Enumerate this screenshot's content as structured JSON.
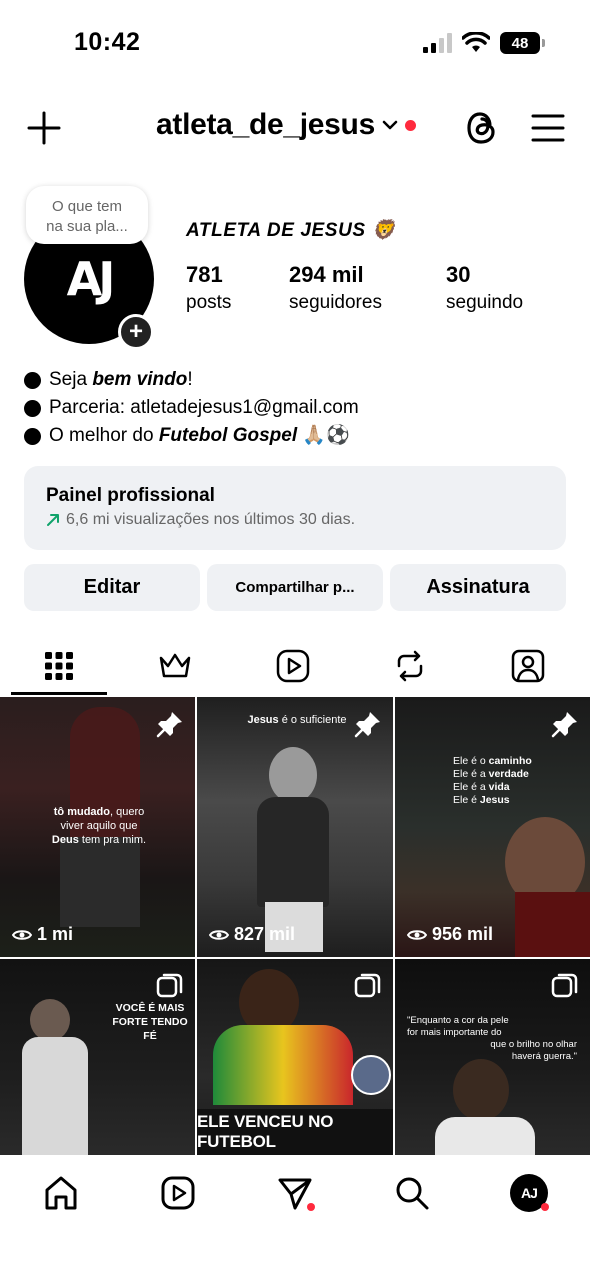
{
  "status_bar": {
    "time": "10:42",
    "battery": "48"
  },
  "header": {
    "username": "atleta_de_jesus",
    "icons": [
      "plus-icon",
      "chevron-down-icon",
      "threads-icon",
      "menu-icon"
    ]
  },
  "profile": {
    "note": [
      "O que tem",
      "na sua pla..."
    ],
    "avatar_monogram": "AJ",
    "display_name": "ATLETA DE JESUS 🦁",
    "stats": [
      {
        "value": "781",
        "label": "posts"
      },
      {
        "value": "294 mil",
        "label": "seguidores"
      },
      {
        "value": "30",
        "label": "seguindo"
      }
    ],
    "bio": {
      "line1_prefix": "Seja ",
      "line1_bold": "bem vindo",
      "line1_suffix": "!",
      "line2": "Parceria: atletadejesus1@gmail.com",
      "line3_prefix": "O melhor do ",
      "line3_bold": "Futebol Gospel",
      "line3_suffix": " 🙏🏼⚽"
    }
  },
  "professional_panel": {
    "title": "Painel profissional",
    "subtitle": "6,6 mi visualizações nos últimos 30 dias."
  },
  "actions": {
    "edit": "Editar",
    "share": "Compartilhar p...",
    "subscription": "Assinatura"
  },
  "tabs": [
    "grid-icon",
    "crown-icon",
    "reels-icon",
    "reposts-icon",
    "tagged-icon"
  ],
  "grid": {
    "tiles": [
      {
        "views": "1 mi",
        "caption_parts": [
          "tô mudado",
          ", quero",
          "viver aquilo que",
          "Deus",
          " tem pra mim."
        ],
        "pinned": true
      },
      {
        "views": "827 mil",
        "caption_parts": [
          "Jesus",
          " é o suficiente"
        ],
        "pinned": true
      },
      {
        "views": "956 mil",
        "caption_parts": [
          "Ele é o ",
          "caminho",
          "Ele é a ",
          "verdade",
          "Ele é a ",
          "vida",
          "Ele é ",
          "Jesus"
        ],
        "pinned": true
      },
      {
        "caption_parts": [
          "VOCÊ É MAIS",
          "FORTE TENDO FÉ"
        ],
        "carousel": true
      },
      {
        "banner": "ELE VENCEU NO FUTEBOL",
        "carousel": true
      },
      {
        "caption_parts": [
          "\"Enquanto a cor da pele",
          "for mais importante do",
          "que o brilho no olhar",
          "haverá guerra.\""
        ],
        "carousel": true
      }
    ]
  },
  "bottom_nav": {
    "items": [
      "home-icon",
      "reels-icon",
      "send-icon",
      "search-icon",
      "profile-avatar"
    ],
    "avatar_monogram": "AJ"
  }
}
